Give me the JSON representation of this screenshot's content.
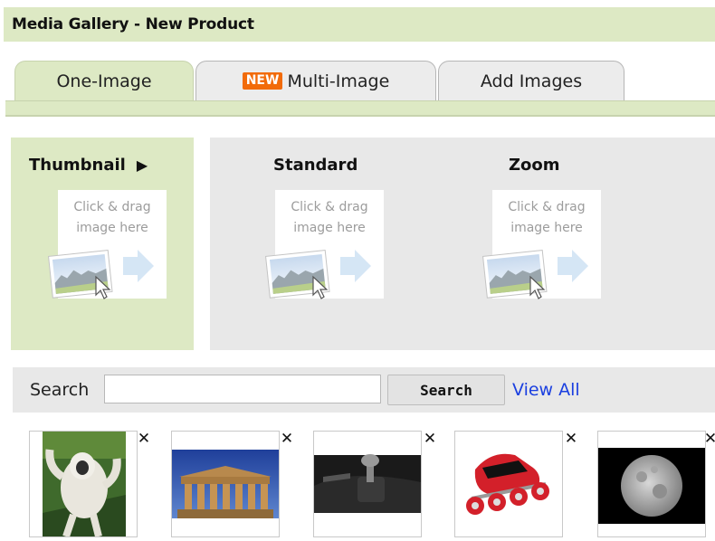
{
  "header": {
    "title": "Media Gallery - New Product"
  },
  "tabs": [
    {
      "label": "One-Image",
      "active": true
    },
    {
      "badge": "NEW",
      "label": "Multi-Image",
      "active": false
    },
    {
      "label": "Add Images",
      "active": false
    }
  ],
  "slots": [
    {
      "title": "Thumbnail",
      "indicator": "▶",
      "drop_line1": "Click & drag",
      "drop_line2": "image here"
    },
    {
      "title": "Standard",
      "drop_line1": "Click & drag",
      "drop_line2": "image here"
    },
    {
      "title": "Zoom",
      "drop_line1": "Click & drag",
      "drop_line2": "image here"
    }
  ],
  "search": {
    "label": "Search",
    "value": "",
    "button_label": "Search",
    "view_all_label": "View All"
  },
  "thumbnails": [
    {
      "subject": "gibbon monkey",
      "close_glyph": "✕"
    },
    {
      "subject": "greek temple",
      "close_glyph": "✕"
    },
    {
      "subject": "gear shift",
      "close_glyph": "✕"
    },
    {
      "subject": "inline skate",
      "close_glyph": "✕"
    },
    {
      "subject": "moon",
      "close_glyph": "✕"
    }
  ],
  "colors": {
    "accent_green": "#dde9c4",
    "panel_gray": "#e8e8e8",
    "badge_orange": "#f26b0a",
    "link_blue": "#1a3fe0"
  }
}
